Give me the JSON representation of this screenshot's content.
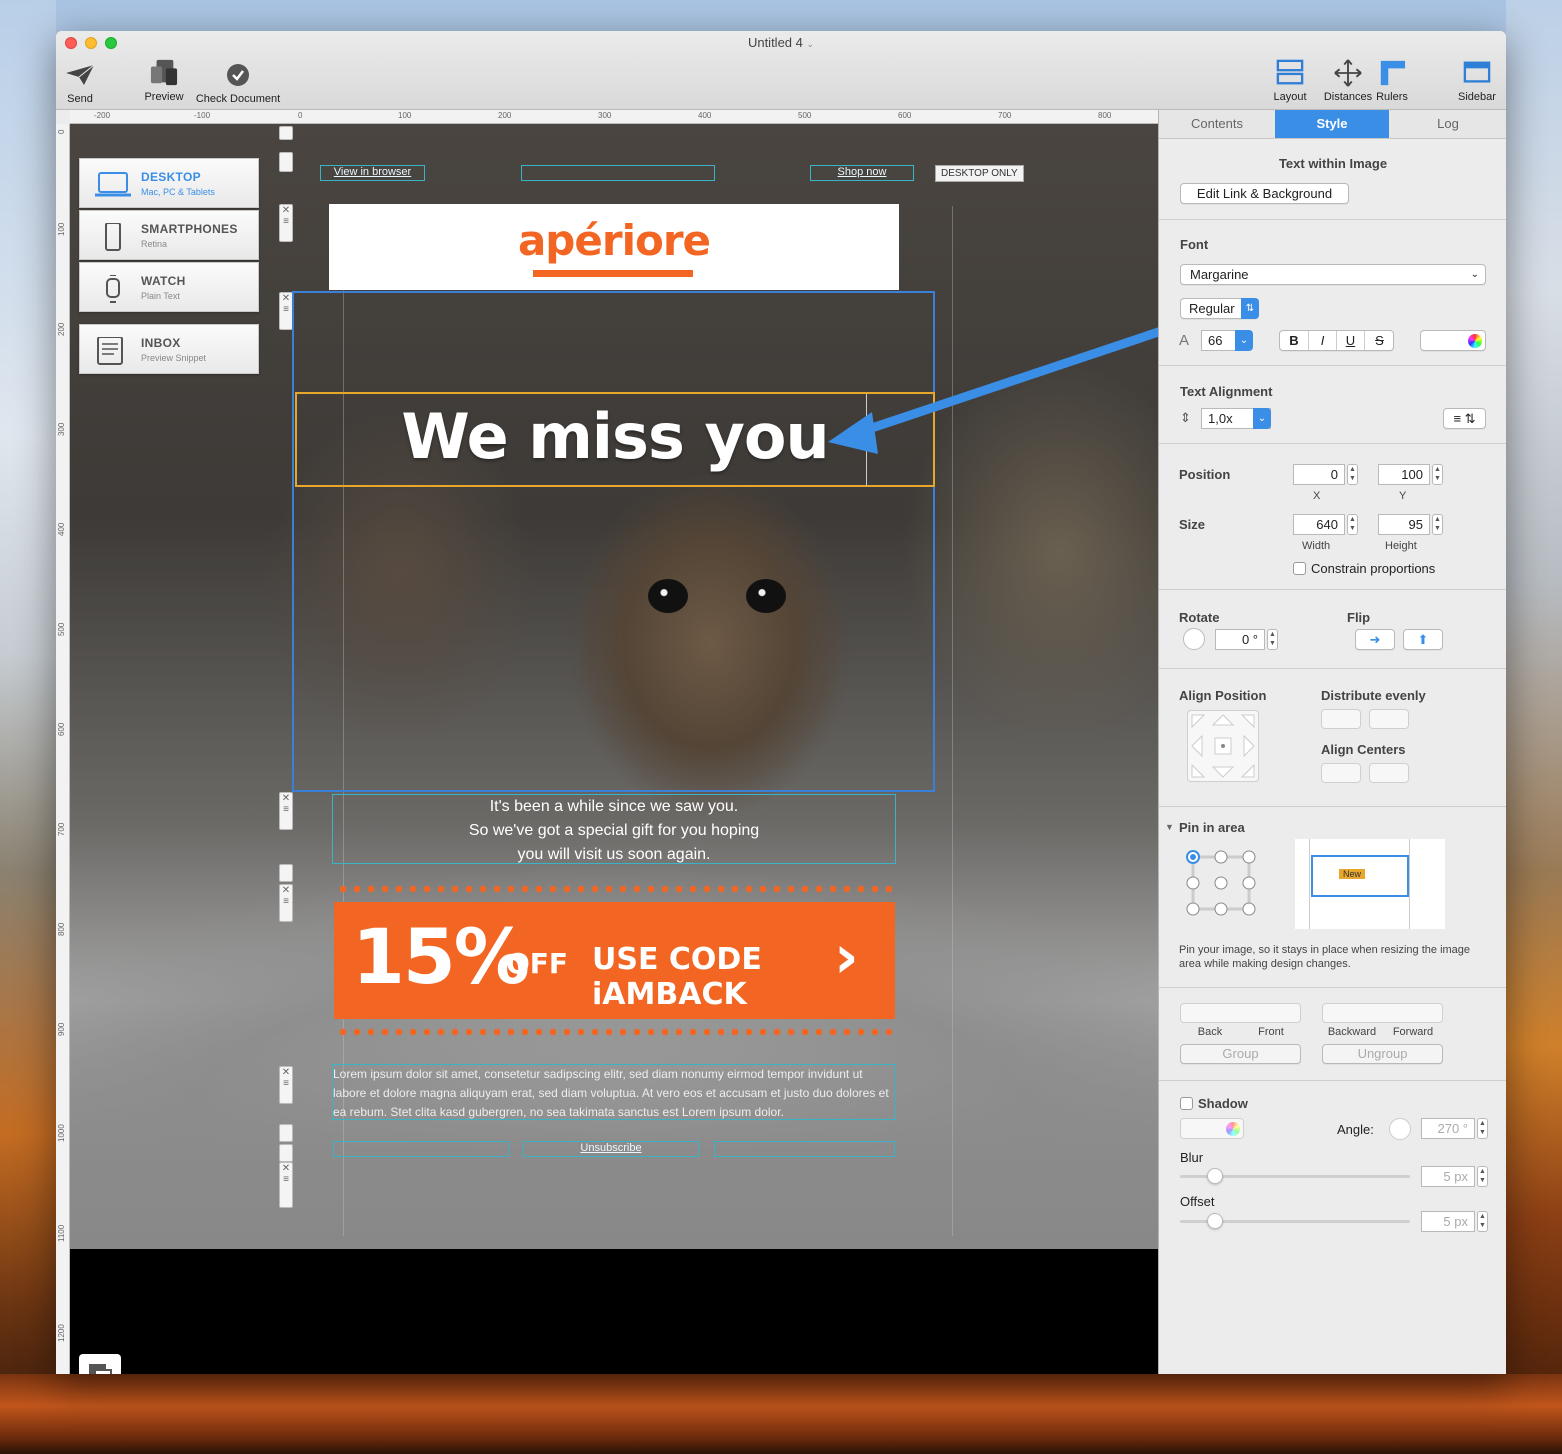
{
  "window": {
    "title": "Untitled 4"
  },
  "toolbar": {
    "send": "Send",
    "preview": "Preview",
    "check": "Check Document",
    "layout": "Layout",
    "distances": "Distances",
    "rulers": "Rulers",
    "sidebar": "Sidebar"
  },
  "ruler": {
    "top": [
      "-200",
      "-100",
      "0",
      "100",
      "200",
      "300",
      "400",
      "500",
      "600",
      "700",
      "800"
    ],
    "left": [
      "0",
      "100",
      "200",
      "300",
      "400",
      "500",
      "600",
      "700",
      "800",
      "900",
      "1000",
      "1100",
      "1200"
    ]
  },
  "devices": [
    {
      "name": "DESKTOP",
      "sub": "Mac, PC & Tablets"
    },
    {
      "name": "SMARTPHONES",
      "sub": "Retina"
    },
    {
      "name": "WATCH",
      "sub": "Plain Text"
    },
    {
      "name": "INBOX",
      "sub": "Preview Snippet"
    }
  ],
  "email": {
    "view_in_browser": "View in browser",
    "shop_now": "Shop now",
    "desktop_only": "DESKTOP ONLY",
    "logo": "apériore",
    "headline": "We miss you",
    "copy": [
      "It's been a while since we saw you.",
      "So we've got a special gift for you hoping",
      "you will visit us soon again."
    ],
    "promo_percent": "15%",
    "promo_off": "OFF",
    "promo_code": "USE CODE iAMBACK",
    "promo_chevron": "›",
    "lorem": "Lorem ipsum dolor sit amet, consetetur sadipscing elitr, sed diam nonumy eirmod tempor invidunt ut labore et dolore magna aliquyam erat, sed diam voluptua. At vero eos et accusam et justo duo dolores et ea rebum. Stet clita kasd gubergren, no sea takimata sanctus est Lorem ipsum dolor.",
    "unsubscribe": "Unsubscribe"
  },
  "sidebar": {
    "tabs": [
      "Contents",
      "Style",
      "Log"
    ],
    "active_tab": "Style",
    "section_title": "Text within Image",
    "edit_link": "Edit Link & Background",
    "font_label": "Font",
    "font_name": "Margarine",
    "font_style": "Regular",
    "font_size": "66",
    "format_bold": "B",
    "format_italic": "I",
    "format_underline": "U",
    "format_strike": "S",
    "text_alignment_label": "Text Alignment",
    "line_height": "1,0x",
    "position_label": "Position",
    "pos_x": "0",
    "pos_y": "100",
    "x_label": "X",
    "y_label": "Y",
    "size_label": "Size",
    "width": "640",
    "height": "95",
    "width_label": "Width",
    "height_label": "Height",
    "constrain": "Constrain proportions",
    "rotate_label": "Rotate",
    "rotate_value": "0 °",
    "flip_label": "Flip",
    "align_position": "Align Position",
    "distribute_evenly": "Distribute evenly",
    "align_centers": "Align Centers",
    "pin_label": "Pin in area",
    "pin_new": "New",
    "pin_help": "Pin your image, so it stays in place when resizing the image area while making design changes.",
    "back": "Back",
    "front": "Front",
    "backward": "Backward",
    "forward": "Forward",
    "group": "Group",
    "ungroup": "Ungroup",
    "shadow": "Shadow",
    "angle_label": "Angle:",
    "angle_value": "270 °",
    "blur_label": "Blur",
    "blur_value": "5 px",
    "offset_label": "Offset",
    "offset_value": "5 px"
  },
  "colors": {
    "accent": "#3a8ee6",
    "brand": "#f26522",
    "selection": "#e6a72c"
  }
}
